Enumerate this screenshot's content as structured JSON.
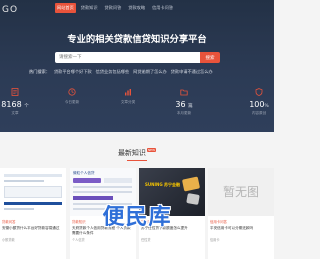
{
  "header": {
    "logo_text": "GO",
    "nav": [
      "网站首页",
      "贷款知识",
      "贷款问答",
      "贷款攻略",
      "信用卡问答"
    ]
  },
  "hero": {
    "headline": "专业的相关贷款信贷知识分享平台",
    "search": {
      "placeholder": "请搜索一下",
      "button": "搜索"
    },
    "hot": {
      "label": "热门搜索：",
      "links": [
        "贷款平台哪个好下款",
        "信贷业务包括哪些",
        "网贷逾期了怎么办",
        "贷款申请不通过怎么办"
      ]
    }
  },
  "stats": [
    {
      "value": "8168",
      "unit": "个",
      "label": "文章",
      "icon": "article-icon"
    },
    {
      "value": "",
      "unit": "",
      "label": "今日更新",
      "icon": "clock-icon"
    },
    {
      "value": "",
      "unit": "",
      "label": "文章分类",
      "icon": "chart-icon"
    },
    {
      "value": "36",
      "unit": "篇",
      "label": "本月更新",
      "icon": "folder-icon"
    },
    {
      "value": "100",
      "unit": "%",
      "label": "内容原创",
      "icon": "shield-icon"
    }
  ],
  "section": {
    "title": "最新知识",
    "badge": "NEW"
  },
  "cards": [
    {
      "category": "贷款问答",
      "title": "安徽小额贷什么平台好贷款容易通过",
      "desc": "小额贷款"
    },
    {
      "category": "贷款知识",
      "title": "天府贷款个人信用贷款流程 个人贷款需要什么条件",
      "thumb_text": "微粒个人信贷",
      "desc": "个人信贷"
    },
    {
      "category": "贷款攻略",
      "title": "苏宁任性贷下款额度怎么提升",
      "thumb_text": "SUNING 苏宁金融",
      "desc": "任性贷"
    },
    {
      "category": "信用卡问答",
      "title": "平安信用卡可以分期还款吗",
      "thumb_text": "暂无图",
      "desc": "信用卡"
    }
  ],
  "watermark": "便民库"
}
